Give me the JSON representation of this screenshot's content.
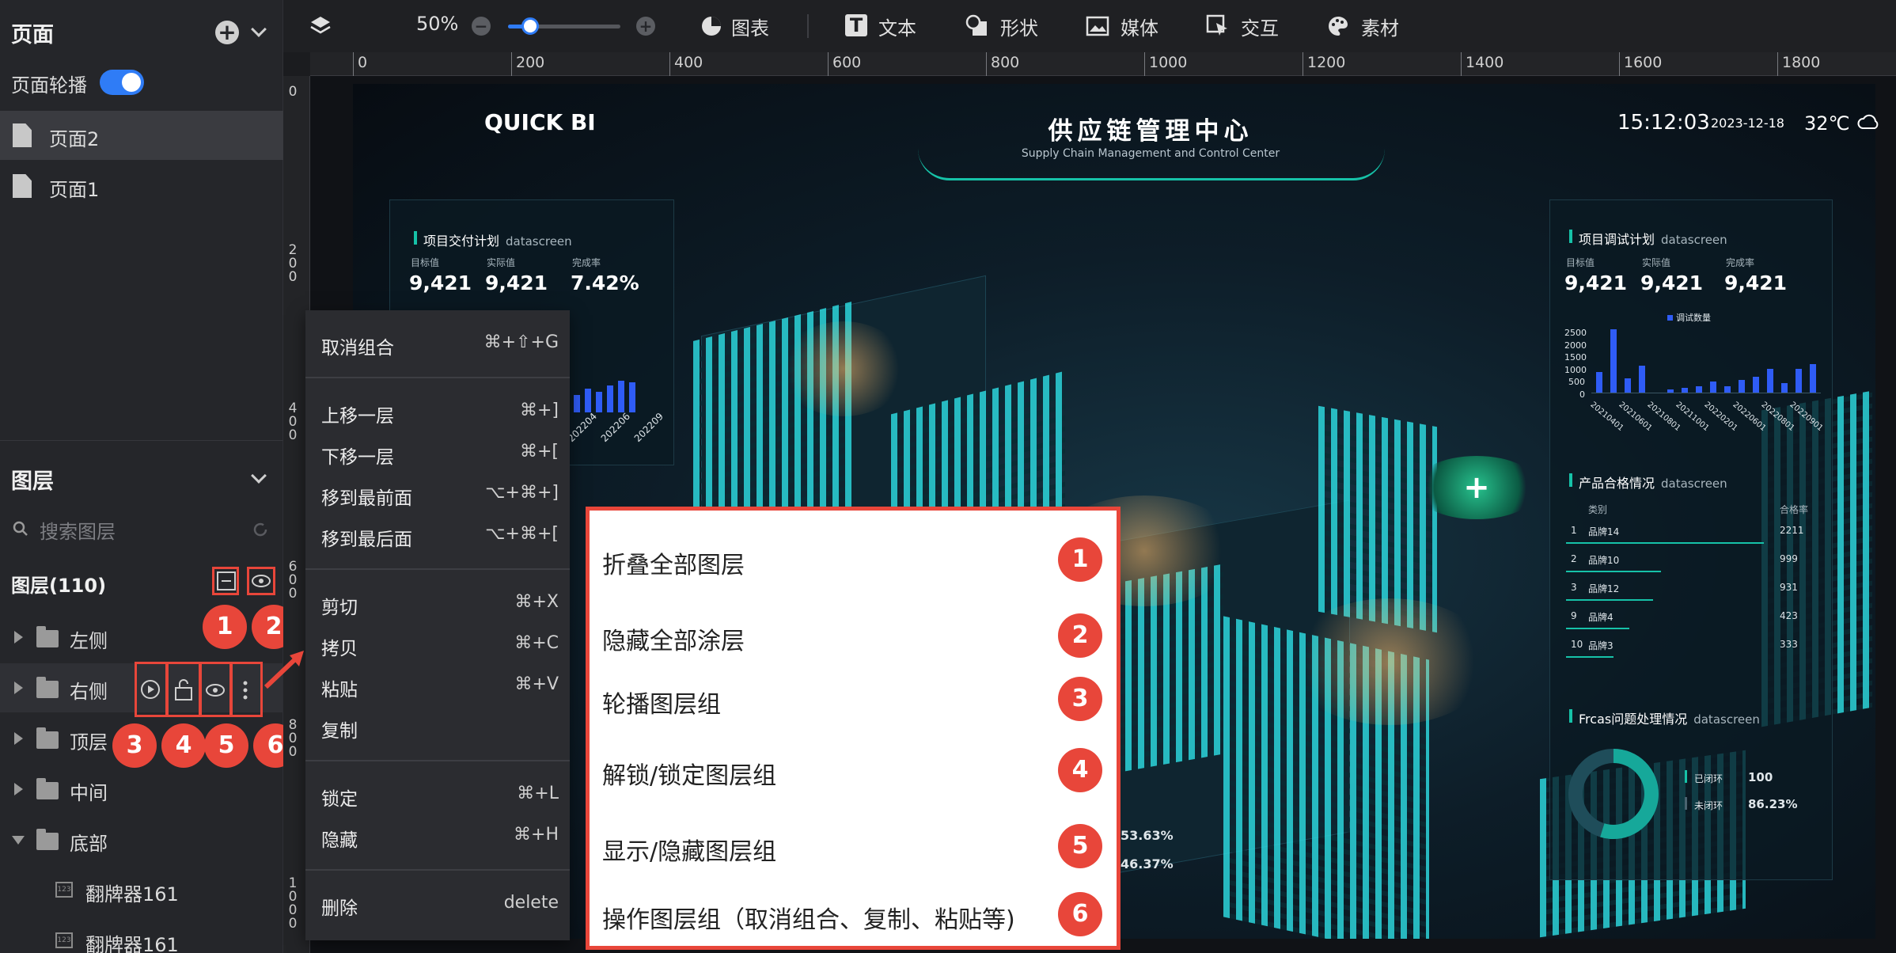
{
  "pages_panel": {
    "title": "页面",
    "carousel_label": "页面轮播",
    "pages": [
      "页面2",
      "页面1"
    ]
  },
  "layers_panel": {
    "title": "图层",
    "search_placeholder": "搜索图层",
    "count_label": "图层(110)",
    "groups": [
      "左侧",
      "右侧",
      "顶层",
      "中间",
      "底部"
    ],
    "children": [
      "翻牌器161",
      "翻牌器161"
    ]
  },
  "toolbar": {
    "zoom": "50%",
    "zoom_fraction": 0.2,
    "items": [
      "图表",
      "文本",
      "形状",
      "媒体",
      "交互",
      "素材"
    ]
  },
  "ruler": {
    "h_labels": [
      "0",
      "200",
      "400",
      "600",
      "800",
      "1000",
      "1200",
      "1400",
      "1600",
      "1800"
    ],
    "v_labels": [
      "0",
      "200",
      "400",
      "600",
      "800",
      "1000"
    ]
  },
  "dashboard": {
    "brand": "QUICK BI",
    "title": "供应链管理中心",
    "subtitle": "Supply Chain Management and Control Center",
    "time": "15:12:03",
    "date": "2023-12-18",
    "temp": "32℃",
    "card1": {
      "title": "项目交付计划",
      "sub": "datascreen",
      "labels": [
        "目标值",
        "实际值",
        "完成率"
      ],
      "values": [
        "9,421",
        "9,421",
        "7.42%"
      ],
      "x_ticks": [
        "202204",
        "202206",
        "202209"
      ]
    },
    "card2": {
      "title": "项目调试计划",
      "sub": "datascreen",
      "labels": [
        "目标值",
        "实际值",
        "完成率"
      ],
      "values": [
        "9,421",
        "9,421",
        "9,421"
      ],
      "legend": "调试数量",
      "y_ticks": [
        "2500",
        "2000",
        "1500",
        "1000",
        "500",
        "0"
      ],
      "x_ticks": [
        "20210401",
        "20210601",
        "20210801",
        "20211001",
        "20220201",
        "20220601",
        "20220801",
        "20220901"
      ]
    },
    "card3": {
      "title": "产品合格情况",
      "sub": "datascreen",
      "headers": [
        "类别",
        "合格率"
      ],
      "rows": [
        {
          "rank": "1",
          "name": "品牌14",
          "value": "2211"
        },
        {
          "rank": "2",
          "name": "品牌10",
          "value": "999"
        },
        {
          "rank": "3",
          "name": "品牌12",
          "value": "931"
        },
        {
          "rank": "9",
          "name": "品牌4",
          "value": "423"
        },
        {
          "rank": "10",
          "name": "品牌3",
          "value": "333"
        }
      ]
    },
    "card4": {
      "title": "Frcas问题处理情况",
      "sub": "datascreen",
      "closed_label": "已闭环",
      "closed_value": "100",
      "open_label": "未闭环",
      "open_value": "86.23%"
    },
    "floating_pcts": [
      "53.63%",
      "46.37%"
    ]
  },
  "context_menu": {
    "items": [
      {
        "label": "取消组合",
        "key": "⌘+⇧+G"
      },
      {
        "label": "上移一层",
        "key": "⌘+]"
      },
      {
        "label": "下移一层",
        "key": "⌘+["
      },
      {
        "label": "移到最前面",
        "key": "⌥+⌘+]"
      },
      {
        "label": "移到最后面",
        "key": "⌥+⌘+["
      },
      {
        "label": "剪切",
        "key": "⌘+X"
      },
      {
        "label": "拷贝",
        "key": "⌘+C"
      },
      {
        "label": "粘贴",
        "key": "⌘+V"
      },
      {
        "label": "复制",
        "key": ""
      },
      {
        "label": "锁定",
        "key": "⌘+L"
      },
      {
        "label": "隐藏",
        "key": "⌘+H"
      },
      {
        "label": "删除",
        "key": "delete"
      }
    ]
  },
  "legend": {
    "items": [
      "折叠全部图层",
      "隐藏全部涂层",
      "轮播图层组",
      "解锁/锁定图层组",
      "显示/隐藏图层组",
      "操作图层组（取消组合、复制、粘贴等)"
    ],
    "badges": [
      "1",
      "2",
      "3",
      "4",
      "5",
      "6"
    ]
  },
  "colors": {
    "accent": "#2f7cf6",
    "annotation": "#e8463a",
    "teal": "#16c2a8"
  }
}
